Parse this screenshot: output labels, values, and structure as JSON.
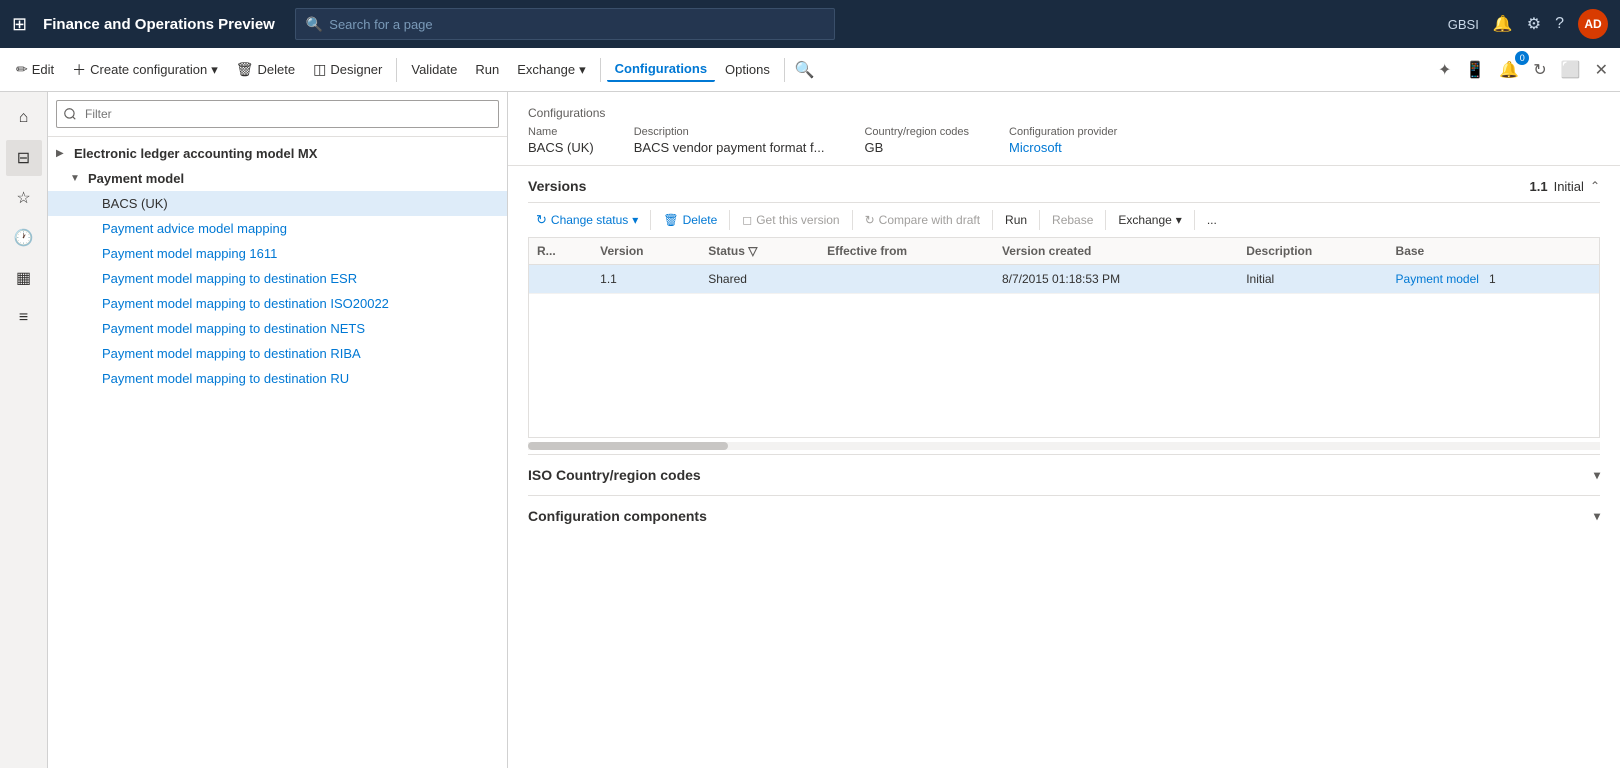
{
  "app": {
    "title": "Finance and Operations Preview",
    "user": "GBSI",
    "avatar": "AD"
  },
  "search": {
    "placeholder": "Search for a page"
  },
  "toolbar": {
    "edit": "Edit",
    "create_config": "Create configuration",
    "delete": "Delete",
    "designer": "Designer",
    "validate": "Validate",
    "run": "Run",
    "exchange": "Exchange",
    "configurations": "Configurations",
    "options": "Options"
  },
  "tree": {
    "filter_placeholder": "Filter",
    "items": [
      {
        "label": "Electronic ledger accounting model MX",
        "indent": 0,
        "expand": "▶",
        "bold": true,
        "link": false
      },
      {
        "label": "Payment model",
        "indent": 1,
        "expand": "▼",
        "bold": true,
        "link": false
      },
      {
        "label": "BACS (UK)",
        "indent": 2,
        "expand": "",
        "bold": false,
        "link": false,
        "selected": true
      },
      {
        "label": "Payment advice model mapping",
        "indent": 2,
        "expand": "",
        "bold": false,
        "link": true
      },
      {
        "label": "Payment model mapping 1611",
        "indent": 2,
        "expand": "",
        "bold": false,
        "link": true
      },
      {
        "label": "Payment model mapping to destination ESR",
        "indent": 2,
        "expand": "",
        "bold": false,
        "link": true
      },
      {
        "label": "Payment model mapping to destination ISO20022",
        "indent": 2,
        "expand": "",
        "bold": false,
        "link": true
      },
      {
        "label": "Payment model mapping to destination NETS",
        "indent": 2,
        "expand": "",
        "bold": false,
        "link": true
      },
      {
        "label": "Payment model mapping to destination RIBA",
        "indent": 2,
        "expand": "",
        "bold": false,
        "link": true
      },
      {
        "label": "Payment model mapping to destination RU",
        "indent": 2,
        "expand": "",
        "bold": false,
        "link": true
      }
    ]
  },
  "configurations": {
    "header_label": "Configurations",
    "fields": {
      "name_label": "Name",
      "name_value": "BACS (UK)",
      "description_label": "Description",
      "description_value": "BACS vendor payment format f...",
      "country_label": "Country/region codes",
      "country_value": "GB",
      "provider_label": "Configuration provider",
      "provider_value": "Microsoft"
    }
  },
  "versions": {
    "section_title": "Versions",
    "version_num": "1.1",
    "version_status": "Initial",
    "toolbar": {
      "change_status": "Change status",
      "delete": "Delete",
      "get_this_version": "Get this version",
      "compare_with_draft": "Compare with draft",
      "run": "Run",
      "rebase": "Rebase",
      "exchange": "Exchange",
      "more": "..."
    },
    "table": {
      "columns": [
        "R...",
        "Version",
        "Status",
        "Effective from",
        "Version created",
        "Description",
        "Base"
      ],
      "rows": [
        {
          "r": "",
          "version": "1.1",
          "status": "Shared",
          "effective_from": "",
          "version_created": "8/7/2015 01:18:53 PM",
          "description": "Initial",
          "base": "Payment model",
          "base_num": "1",
          "selected": true
        }
      ]
    }
  },
  "iso_section": {
    "title": "ISO Country/region codes"
  },
  "components_section": {
    "title": "Configuration components"
  }
}
